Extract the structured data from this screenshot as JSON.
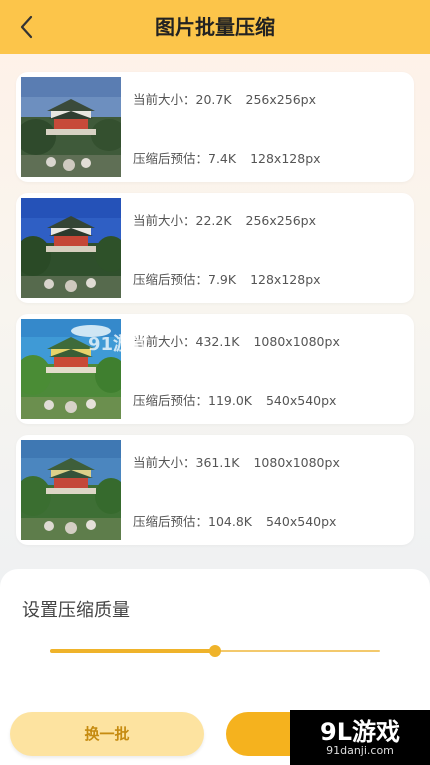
{
  "header": {
    "title": "图片批量压缩",
    "back_icon": "chevron-left-icon",
    "bg_color": "#fcc54a"
  },
  "images": [
    {
      "current": "当前大小：20.7K",
      "current_dim": "256x256px",
      "estimated": "压缩后预估：7.4K",
      "estimated_dim": "128x128px"
    },
    {
      "current": "当前大小：22.2K",
      "current_dim": "256x256px",
      "estimated": "压缩后预估：7.9K",
      "estimated_dim": "128x128px"
    },
    {
      "current": "当前大小：432.1K",
      "current_dim": "1080x1080px",
      "estimated": "压缩后预估：119.0K",
      "estimated_dim": "540x540px"
    },
    {
      "current": "当前大小：361.1K",
      "current_dim": "1080x1080px",
      "estimated": "压缩后预估：104.8K",
      "estimated_dim": "540x540px"
    }
  ],
  "quality": {
    "title": "设置压缩质量",
    "value": 0.5,
    "accent_color": "#efb32a"
  },
  "actions": {
    "refresh_label": "换一批"
  },
  "watermark": {
    "brand": "9L游戏",
    "url": "91danji.com",
    "center": "91游戏"
  }
}
